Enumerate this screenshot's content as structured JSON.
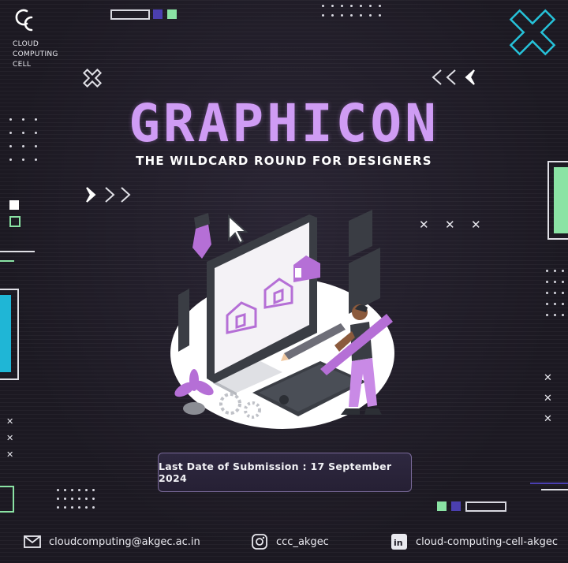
{
  "logo": {
    "icon": "cc-logo-icon",
    "line1": "CLOUD",
    "line2": "COMPUTING",
    "line3": "CELL"
  },
  "title": "GRAPHICON",
  "subtitle": "THE WILDCARD ROUND FOR DESIGNERS",
  "submission_text": "Last Date of Submission : 17 September 2024",
  "footer": {
    "email": "cloudcomputing@akgec.ac.in",
    "instagram": "ccc_akgec",
    "linkedin": "cloud-computing-cell-akgec"
  },
  "colors": {
    "accent_purple": "#cf9cf4",
    "brand_indigo": "#4b3fb0",
    "mint": "#8ae3a4",
    "teal": "#1fb6d6",
    "background": "#1d1a24"
  }
}
